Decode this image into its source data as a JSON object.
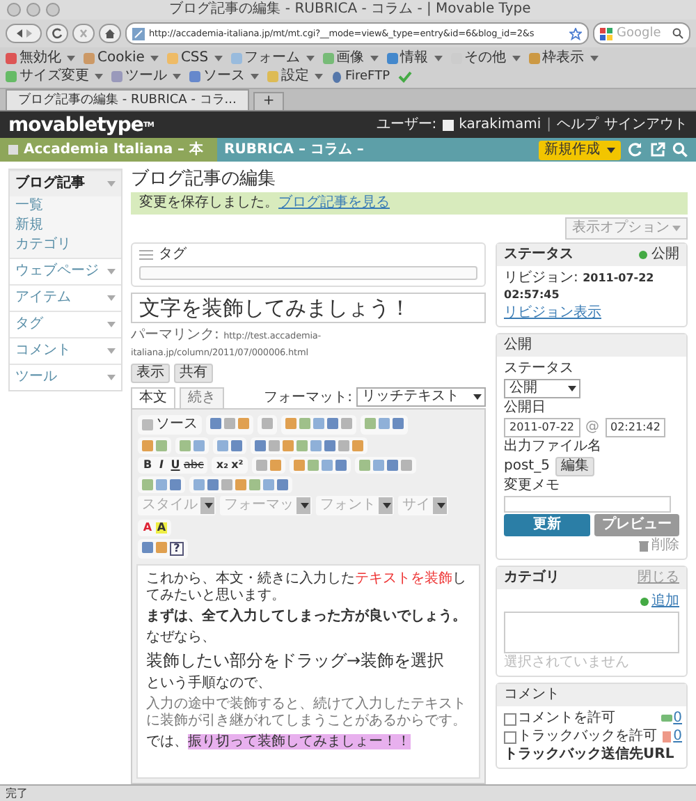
{
  "window": {
    "title": "ブログ記事の編集 - RUBRICA - コラム - | Movable Type"
  },
  "browser": {
    "url": "http://accademia-italiana.jp/mt/mt.cgi?__mode=view&_type=entry&id=6&blog_id=2&s",
    "search_placeholder": "Google",
    "toolbar": [
      {
        "label": "無効化"
      },
      {
        "label": "Cookie"
      },
      {
        "label": "CSS"
      },
      {
        "label": "フォーム"
      },
      {
        "label": "画像"
      },
      {
        "label": "情報"
      },
      {
        "label": "その他"
      },
      {
        "label": "枠表示"
      },
      {
        "label": "サイズ変更"
      },
      {
        "label": "ツール"
      },
      {
        "label": "ソース"
      },
      {
        "label": "設定"
      }
    ],
    "ftp_label": "FireFTP",
    "tabs": [
      {
        "label": "ブログ記事の編集 - RUBRICA - コラ...",
        "selected": true
      }
    ],
    "new_tab": "+"
  },
  "header": {
    "logo": "movabletype",
    "logo_mark": "TM",
    "user_label": "ユーザー:",
    "user": "karakimami",
    "separator": "|",
    "help": "ヘルプ",
    "signout": "サインアウト"
  },
  "nav": {
    "site": "Accademia Italiana – 本",
    "blog": "RUBRICA – コラム –",
    "new_button": "新規作成"
  },
  "sidebar": [
    {
      "label": "ブログ記事",
      "expanded": true,
      "children": [
        {
          "label": "一覧"
        },
        {
          "label": "新規"
        },
        {
          "label": "カテゴリ"
        }
      ]
    },
    {
      "label": "ウェブページ",
      "expanded": false
    },
    {
      "label": "アイテム",
      "expanded": false
    },
    {
      "label": "タグ",
      "expanded": false
    },
    {
      "label": "コメント",
      "expanded": false
    },
    {
      "label": "ツール",
      "expanded": false
    }
  ],
  "page": {
    "title": "ブログ記事の編集",
    "message": "変更を保存しました。",
    "message_link": "ブログ記事を見る",
    "display_options": "表示オプション"
  },
  "tags": {
    "label": "タグ"
  },
  "entry": {
    "title": "文字を装飾してみましょう！",
    "permalink_label": "パーマリンク:",
    "permalink": "http://test.accademia-italiana.jp/column/2011/07/000006.html",
    "view_button": "表示",
    "share_button": "共有",
    "tabs": [
      {
        "label": "本文",
        "selected": true
      },
      {
        "label": "続き",
        "selected": false
      }
    ],
    "format_label": "フォーマット:",
    "format": "リッチテキスト",
    "source_button": "ソース",
    "text_tools": [
      "B",
      "I",
      "U",
      "abc",
      "x₂",
      "x²"
    ],
    "dropdowns": [
      "スタイル",
      "フォーマッ",
      "フォント",
      "サイ"
    ],
    "text_color_glyph": "A",
    "highlight_glyph": "A",
    "help_glyph": "?",
    "body": [
      {
        "kind": "para",
        "parts": [
          {
            "kind": "plain",
            "text": "これから、本文・続きに入力した"
          },
          {
            "kind": "red",
            "text": "テキストを装飾"
          },
          {
            "kind": "plain",
            "text": "してみたいと思います。"
          }
        ]
      },
      {
        "kind": "bold",
        "parts": [
          {
            "kind": "plain",
            "text": "まずは、全て入力してしまった方が良いでしょう。"
          }
        ]
      },
      {
        "kind": "para",
        "parts": [
          {
            "kind": "plain",
            "text": "なぜなら、"
          }
        ]
      },
      {
        "kind": "heading",
        "parts": [
          {
            "kind": "plain",
            "text": "装飾したい部分をドラッグ→装飾を選択"
          }
        ]
      },
      {
        "kind": "para",
        "parts": [
          {
            "kind": "plain",
            "text": "という手順なので、"
          }
        ]
      },
      {
        "kind": "grey",
        "parts": [
          {
            "kind": "plain",
            "text": "入力の途中で装飾すると、続けて入力したテキストに装飾が引き継がれてしまうことがあるからです。"
          }
        ]
      },
      {
        "kind": "para",
        "parts": [
          {
            "kind": "plain",
            "text": "では、"
          },
          {
            "kind": "marked",
            "text": "振り切って装飾してみましょー！！"
          }
        ]
      }
    ]
  },
  "status": {
    "title": "ステータス",
    "state": "公開",
    "revision_label": "リビジョン:",
    "revision": "2011-07-22 02:57:45",
    "revision_link": "リビジョン表示"
  },
  "publish": {
    "title": "公開",
    "status_label": "ステータス",
    "status": "公開",
    "date_label": "公開日",
    "date": "2011-07-22",
    "at": "@",
    "time": "02:21:42",
    "file_label": "出力ファイル名",
    "file": "post_5",
    "edit_button": "編集",
    "memo_label": "変更メモ",
    "update_button": "更新",
    "preview_button": "プレビュー",
    "delete_link": "削除"
  },
  "category": {
    "title": "カテゴリ",
    "close": "閉じる",
    "add": "追加",
    "empty": "選択されていません"
  },
  "comments": {
    "title": "コメント",
    "options": [
      {
        "label": "コメントを許可",
        "checked": false,
        "count": "0"
      },
      {
        "label": "トラックバックを許可",
        "checked": false,
        "count": "0"
      }
    ],
    "trackback_label": "トラックバック送信先URL"
  },
  "status_bar": "完了"
}
